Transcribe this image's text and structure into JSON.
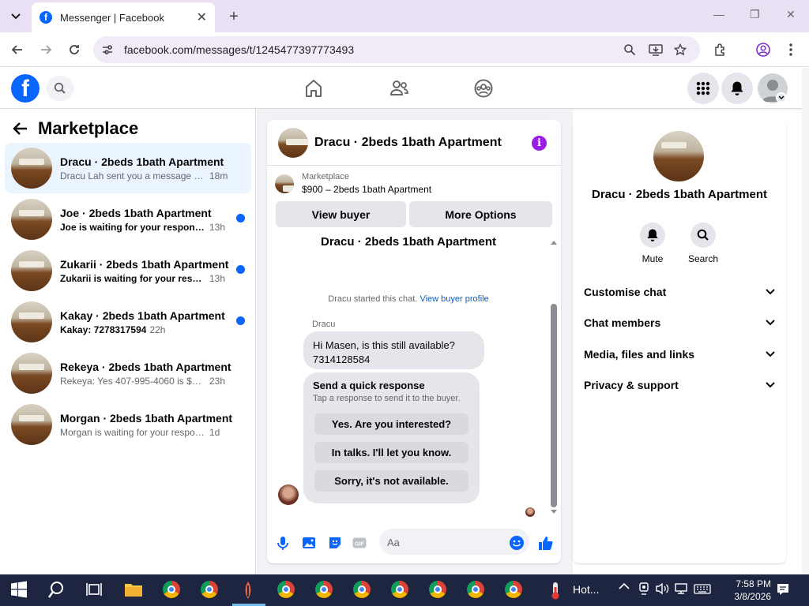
{
  "browser": {
    "tab_title": "Messenger | Facebook",
    "favicon_letter": "f",
    "new_tab_label": "+",
    "url": "facebook.com/messages/t/1245477397773493"
  },
  "facebook": {
    "logo_letter": "f"
  },
  "sidebar": {
    "title": "Marketplace",
    "conversations": [
      {
        "name": "Dracu · 2beds 1bath Apartment",
        "snippet": "Dracu Lah sent you a message abou...",
        "time": "18m",
        "unread": false,
        "selected": true
      },
      {
        "name": "Joe · 2beds 1bath Apartment",
        "snippet": "Joe is waiting for your response.",
        "time": "13h",
        "unread": true,
        "selected": false
      },
      {
        "name": "Zukarii · 2beds 1bath Apartment",
        "snippet": "Zukarii is waiting for your respon...",
        "time": "13h",
        "unread": true,
        "selected": false
      },
      {
        "name": "Kakay · 2beds 1bath Apartment",
        "snippet": "Kakay: 7278317594",
        "time": "22h",
        "unread": true,
        "selected": false
      },
      {
        "name": "Rekeya · 2beds 1bath Apartment",
        "snippet": "Rekeya: Yes 407-995-4060 is $900 th...",
        "time": "23h",
        "unread": false,
        "selected": false
      },
      {
        "name": "Morgan · 2beds 1bath Apartment",
        "snippet": "Morgan is waiting for your response.",
        "time": "1d",
        "unread": false,
        "selected": false
      }
    ]
  },
  "chat": {
    "header_title": "Dracu · 2beds 1bath Apartment",
    "info_label": "i",
    "listing_source": "Marketplace",
    "listing_detail": "$900 – 2beds 1bath Apartment",
    "view_buyer_label": "View buyer",
    "more_options_label": "More Options",
    "conversation_title": "Dracu · 2beds 1bath Apartment",
    "started_text": "Dracu started this chat.",
    "view_profile_link": "View buyer profile",
    "sender_name": "Dracu",
    "message_line1": "Hi Masen, is this still available?",
    "message_line2": "7314128584",
    "quick_response_title": "Send a quick response",
    "quick_response_hint": "Tap a response to send it to the buyer.",
    "quick_responses": [
      "Yes. Are you interested?",
      "In talks. I'll let you know.",
      "Sorry, it's not available."
    ],
    "composer_placeholder": "Aa"
  },
  "details": {
    "name": "Dracu · 2beds 1bath Apartment",
    "actions": [
      {
        "label": "Mute",
        "icon": "bell-icon"
      },
      {
        "label": "Search",
        "icon": "search-icon"
      }
    ],
    "sections": [
      "Customise chat",
      "Chat members",
      "Media, files and links",
      "Privacy & support"
    ]
  },
  "taskbar": {
    "weather_text": "Hot...",
    "time": "7:58 PM",
    "date": "3/8/2026"
  },
  "colors": {
    "facebook_blue": "#0866ff",
    "selected_bg": "#ebf5ff",
    "unread_dot": "#0866ff",
    "info_purple": "#9a1fe5",
    "link": "#0a5fbd"
  }
}
